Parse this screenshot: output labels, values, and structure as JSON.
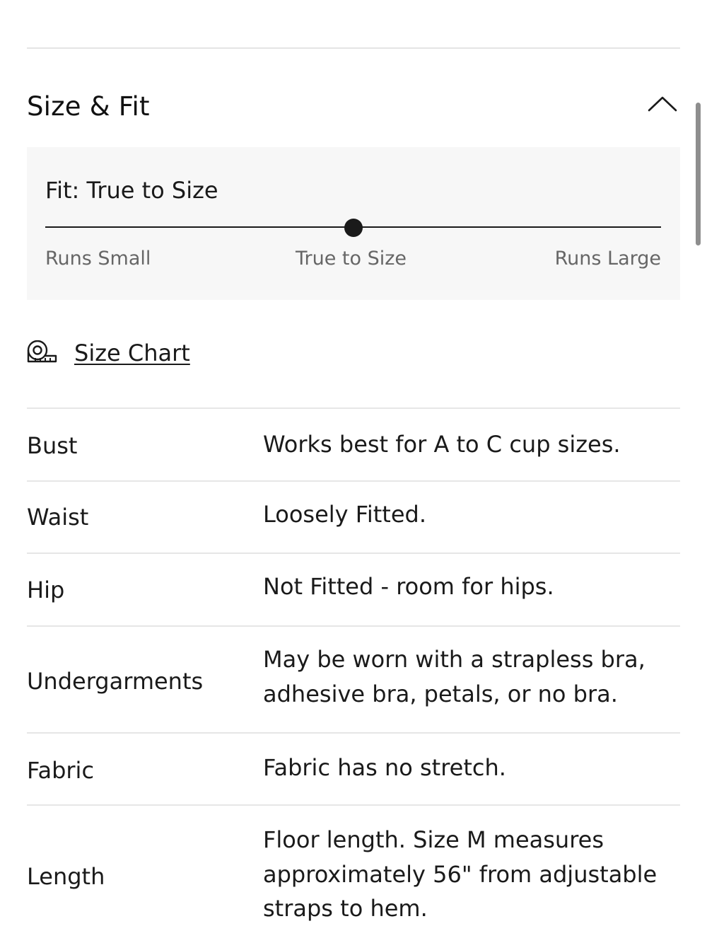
{
  "size_fit": {
    "title": "Size & Fit",
    "toggle_icon": "chevron-up-icon",
    "fit_label": "Fit: True to Size",
    "fit_position": 0.5,
    "scale": {
      "left": "Runs Small",
      "middle": "True to Size",
      "right": "Runs Large"
    },
    "size_chart_icon": "measuring-tape-icon",
    "size_chart_label": "Size Chart",
    "rows": [
      {
        "label": "Bust",
        "value": "Works best for A to C cup sizes."
      },
      {
        "label": "Waist",
        "value": "Loosely Fitted."
      },
      {
        "label": "Hip",
        "value": "Not Fitted - room for hips."
      },
      {
        "label": "Undergarments",
        "value": "May be worn with a strapless bra, adhesive bra, petals, or no bra."
      },
      {
        "label": "Fabric",
        "value": "Fabric has no stretch."
      },
      {
        "label": "Length",
        "value": "Floor length. Size M measures approximately 56\" from adjustable straps to hem."
      }
    ]
  },
  "colors": {
    "text": "#1a1a1a",
    "panel_background": "#f7f7f7",
    "muted_text": "#666666",
    "divider": "#e6e6e6"
  }
}
